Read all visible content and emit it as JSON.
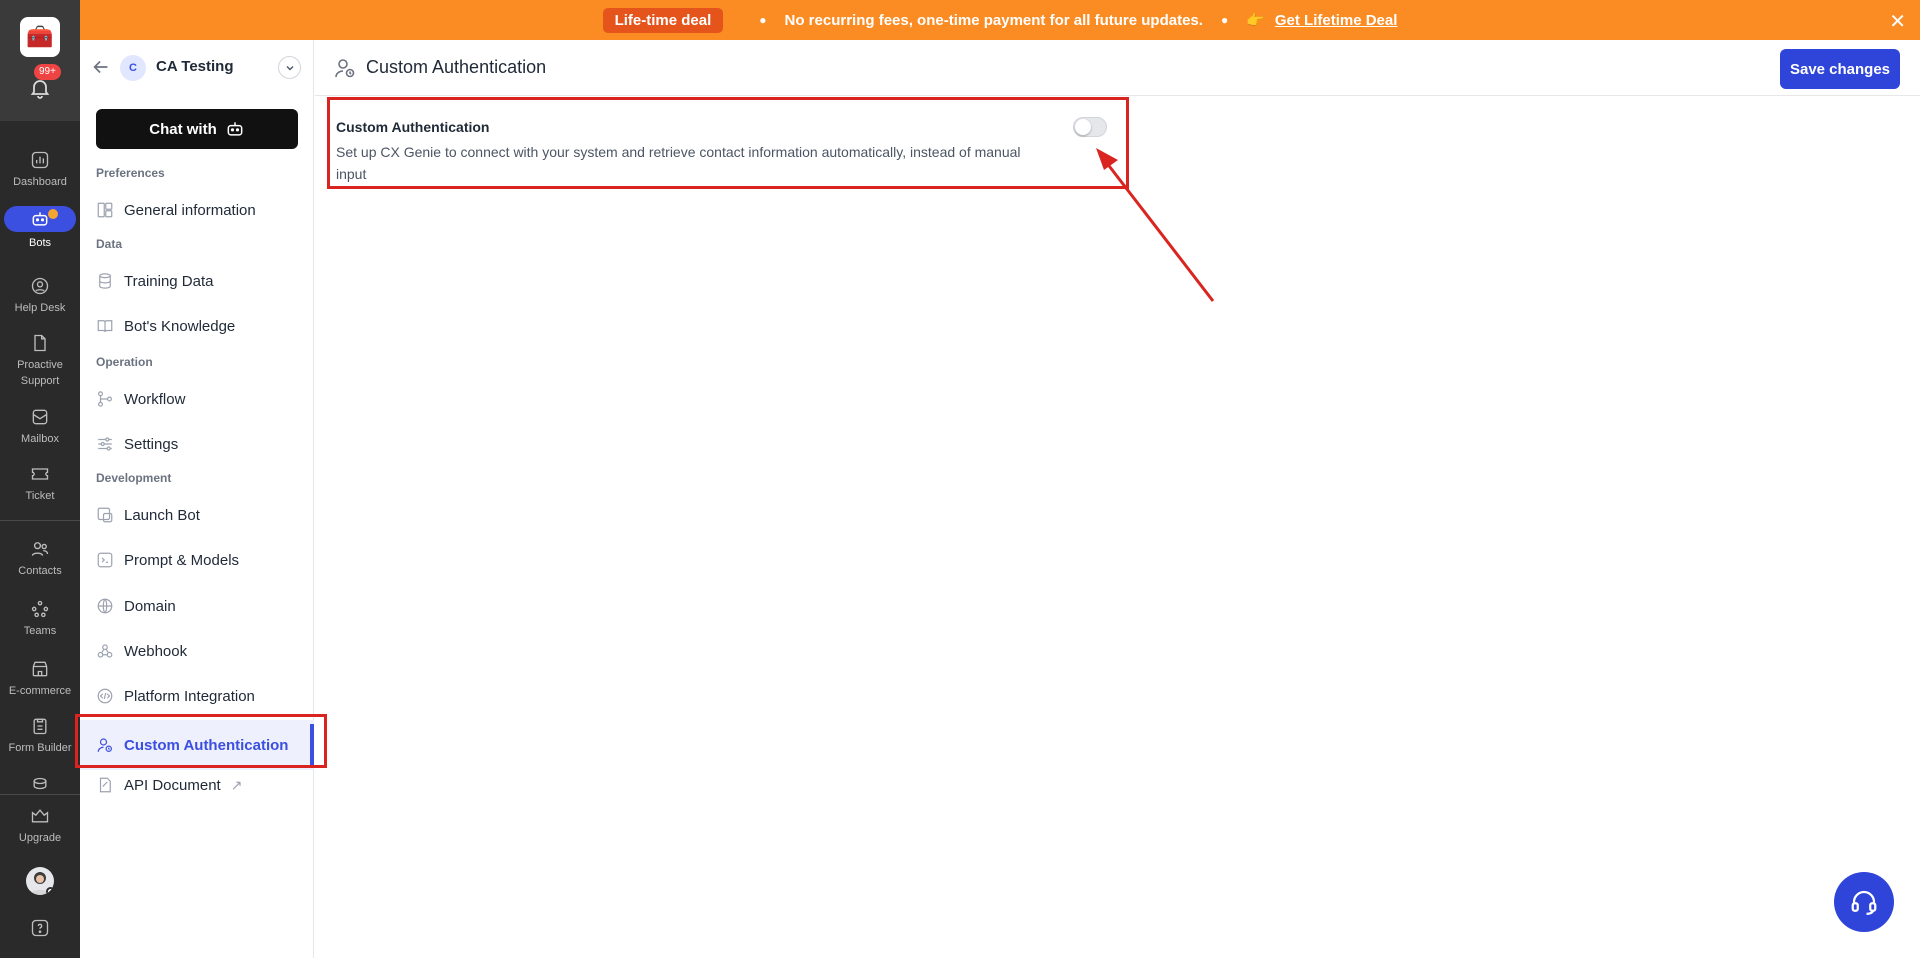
{
  "banner": {
    "deal_label": "Life-time deal",
    "message": "No recurring fees, one-time payment for all future updates.",
    "link_emoji": "👉",
    "link_text": "Get Lifetime Deal",
    "close_glyph": "✕"
  },
  "rail": {
    "notification_count": "99+",
    "items": [
      {
        "label": "Dashboard",
        "icon": "dashboard-icon"
      },
      {
        "label": "Bots",
        "icon": "bot-icon"
      },
      {
        "label": "Help Desk",
        "icon": "help-desk-icon"
      },
      {
        "label": "Proactive Support",
        "icon": "proactive-support-icon"
      },
      {
        "label": "Mailbox",
        "icon": "mailbox-icon"
      },
      {
        "label": "Ticket",
        "icon": "ticket-icon"
      },
      {
        "label": "Contacts",
        "icon": "contacts-icon"
      },
      {
        "label": "Teams",
        "icon": "teams-icon"
      },
      {
        "label": "E-commerce",
        "icon": "ecommerce-icon"
      },
      {
        "label": "Form Builder",
        "icon": "form-builder-icon"
      },
      {
        "label": "Upgrade",
        "icon": "upgrade-icon"
      }
    ]
  },
  "sidebar": {
    "bot_initial": "C",
    "bot_name": "CA Testing",
    "chat_button": "Chat with",
    "sections": {
      "preferences": "Preferences",
      "data": "Data",
      "operation": "Operation",
      "development": "Development"
    },
    "items": {
      "general_information": "General information",
      "training_data": "Training Data",
      "bots_knowledge": "Bot's Knowledge",
      "workflow": "Workflow",
      "settings": "Settings",
      "launch_bot": "Launch Bot",
      "prompt_models": "Prompt & Models",
      "domain": "Domain",
      "webhook": "Webhook",
      "platform_integration": "Platform Integration",
      "custom_authentication": "Custom Authentication",
      "api_document": "API Document"
    }
  },
  "main": {
    "title": "Custom Authentication",
    "save_button": "Save changes",
    "card": {
      "title": "Custom Authentication",
      "description": "Set up CX Genie to connect with your system and retrieve contact information automatically, instead of manual input",
      "toggle_enabled": false
    }
  },
  "colors": {
    "accent": "#2f44d8",
    "banner": "#fb8c23",
    "highlight": "#d9241f"
  }
}
